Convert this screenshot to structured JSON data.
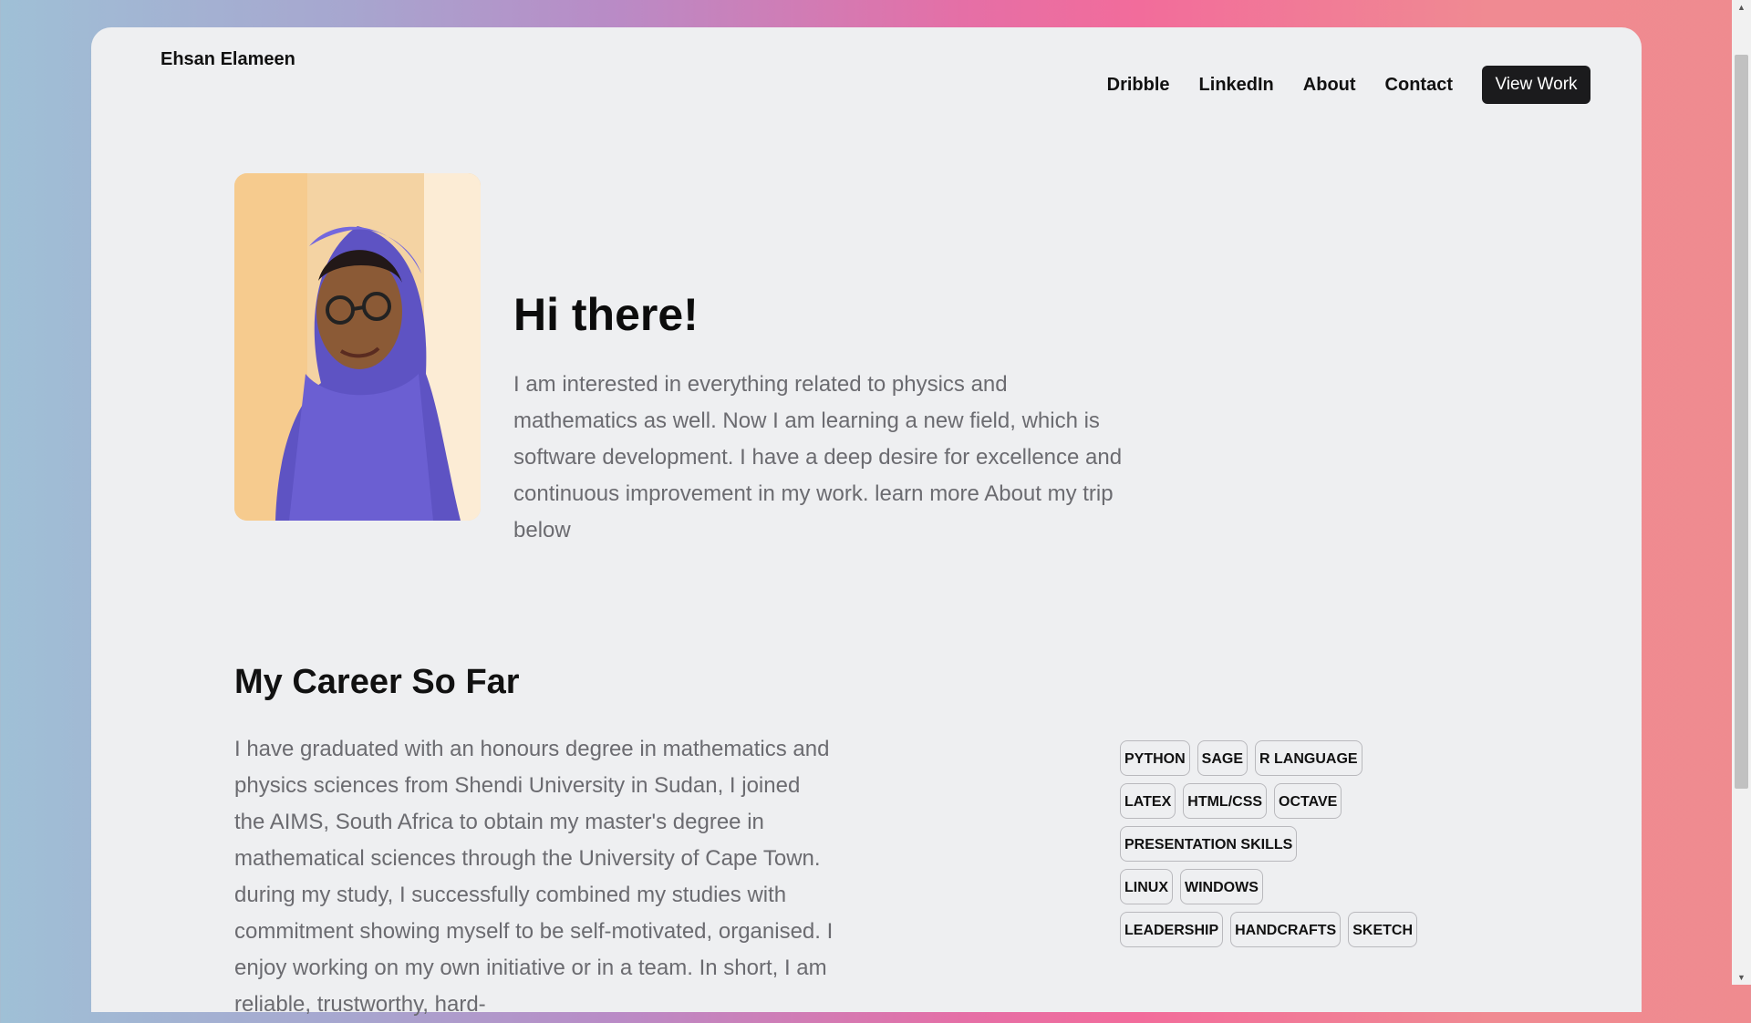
{
  "header": {
    "brand": "Ehsan Elameen",
    "nav": [
      "Dribble",
      "LinkedIn",
      "About",
      "Contact"
    ],
    "cta": "View Work"
  },
  "hero": {
    "title": "Hi there!",
    "text": "I am interested in everything related to physics and mathematics as well. Now I am learning a new field, which is software development. I have a deep desire for excellence and continuous improvement in my work. learn more About my trip below"
  },
  "career": {
    "title": "My Career So Far",
    "text": "I have graduated with an honours degree in mathematics and physics sciences from Shendi University in Sudan, I joined the AIMS, South Africa to obtain my master's degree in mathematical sciences through the University of Cape Town. during my study, I successfully combined my studies with commitment showing myself to be self-motivated, organised. I enjoy working on my own initiative or in a team. In short, I am reliable, trustworthy, hard-"
  },
  "skills": [
    [
      "PYTHON",
      "SAGE",
      "R LANGUAGE"
    ],
    [
      "LATEX",
      "HTML/CSS",
      "OCTAVE"
    ],
    [
      "PRESENTATION SKILLS"
    ],
    [
      "LINUX",
      "WINDOWS"
    ],
    [
      "LEADERSHIP",
      "HANDCRAFTS",
      "SKETCH"
    ]
  ],
  "colors": {
    "cta_bg": "#1b1b1d",
    "page_bg": "#eeeff1",
    "body_text": "#6b6b70"
  }
}
